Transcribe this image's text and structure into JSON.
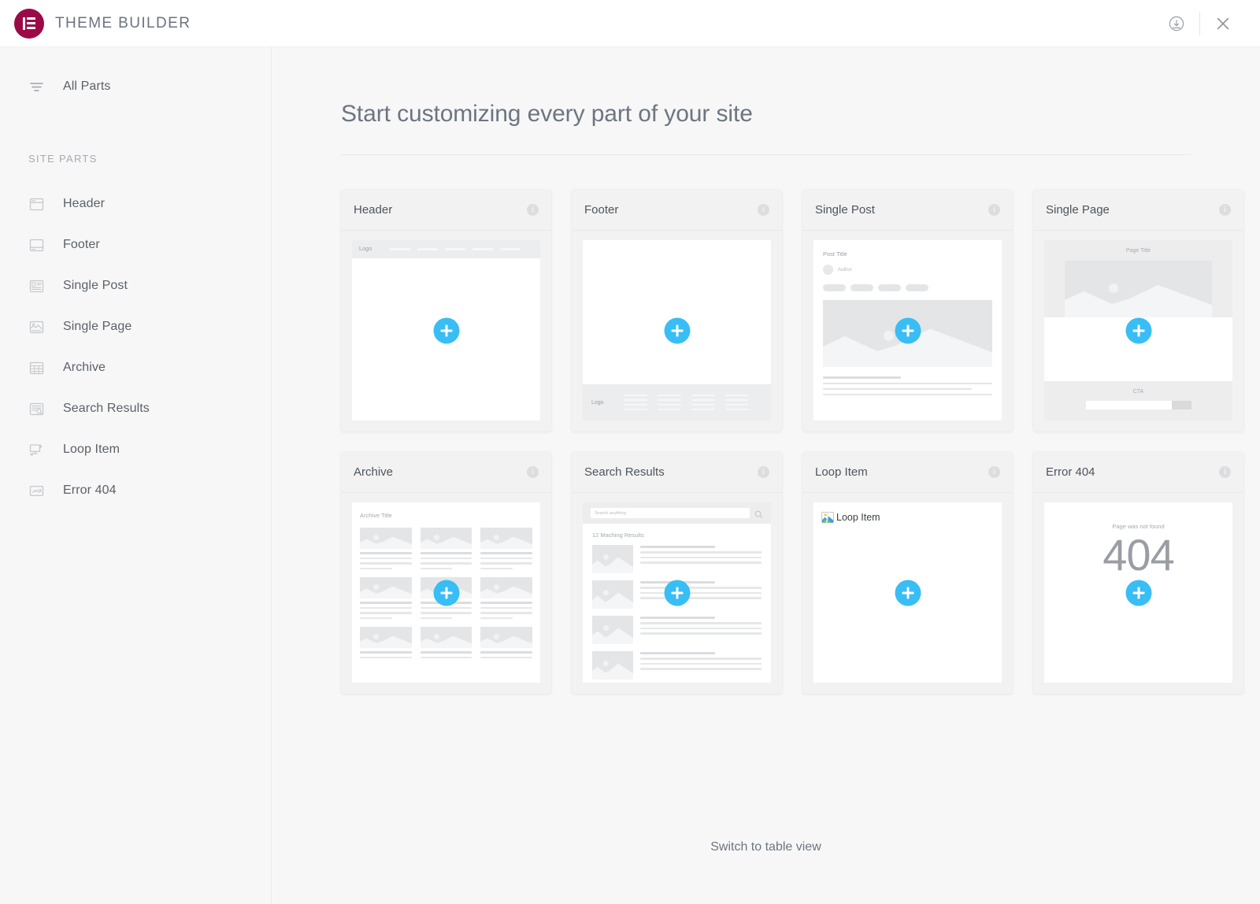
{
  "topbar": {
    "app_title": "THEME BUILDER",
    "logo_icon": "elementor-logo-icon",
    "brand_color": "#9b0a46",
    "actions": [
      {
        "icon": "download-circle-icon",
        "name": "download-button"
      },
      {
        "icon": "close-icon",
        "name": "close-button"
      }
    ]
  },
  "sidebar": {
    "all_parts": {
      "label": "All Parts",
      "icon": "filter-icon"
    },
    "section_label": "SITE PARTS",
    "items": [
      {
        "label": "Header",
        "icon": "header-layout-icon"
      },
      {
        "label": "Footer",
        "icon": "footer-layout-icon"
      },
      {
        "label": "Single Post",
        "icon": "single-post-icon"
      },
      {
        "label": "Single Page",
        "icon": "single-page-icon"
      },
      {
        "label": "Archive",
        "icon": "archive-grid-icon"
      },
      {
        "label": "Search Results",
        "icon": "search-results-icon"
      },
      {
        "label": "Loop Item",
        "icon": "loop-item-icon"
      },
      {
        "label": "Error 404",
        "icon": "error-404-icon"
      }
    ]
  },
  "main": {
    "page_title": "Start customizing every part of your site",
    "switch_view_label": "Switch to table view",
    "add_button_label": "+",
    "accent_color": "#39bdf5",
    "info_icon_label": "i",
    "cards": [
      {
        "title": "Header",
        "preview": {
          "logo_label": "Logo",
          "nav_items": 5
        }
      },
      {
        "title": "Footer",
        "preview": {
          "logo_label": "Logo",
          "columns": 4,
          "links_per_column": 4
        }
      },
      {
        "title": "Single Post",
        "preview": {
          "post_title": "Post Title",
          "author_label": "Author",
          "tags": 4,
          "body_lines": 4
        }
      },
      {
        "title": "Single Page",
        "preview": {
          "page_title": "Page Title",
          "cta_label": "CTA"
        }
      },
      {
        "title": "Archive",
        "preview": {
          "archive_title": "Archive Title",
          "grid_columns": 3,
          "grid_rows": 3
        }
      },
      {
        "title": "Search Results",
        "preview": {
          "search_placeholder": "Search anything",
          "results_count_label": "12 Maching Results",
          "result_rows": 4
        }
      },
      {
        "title": "Loop Item",
        "preview": {
          "broken_image_alt": "Loop Item"
        }
      },
      {
        "title": "Error 404",
        "preview": {
          "message": "Page was not found",
          "code": "404"
        }
      }
    ]
  }
}
